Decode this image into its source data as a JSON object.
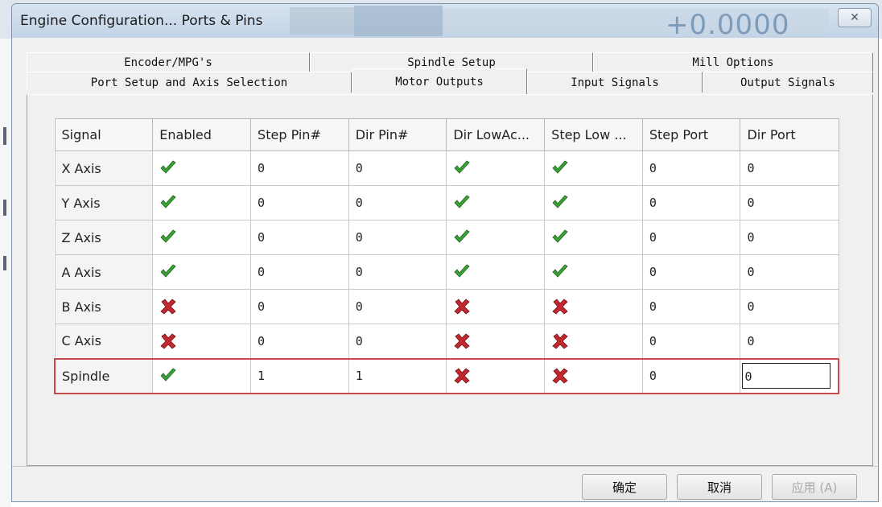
{
  "window": {
    "title": "Engine Configuration... Ports & Pins",
    "background_dro": "+0.0000",
    "close_label": "✕"
  },
  "tabs": {
    "row1": [
      "Encoder/MPG's",
      "Spindle Setup",
      "Mill Options"
    ],
    "row2": [
      "Port Setup and Axis Selection",
      "Motor Outputs",
      "Input Signals",
      "Output Signals"
    ],
    "active": "Motor Outputs"
  },
  "grid": {
    "columns": [
      "Signal",
      "Enabled",
      "Step Pin#",
      "Dir Pin#",
      "Dir LowAc...",
      "Step Low ...",
      "Step Port",
      "Dir Port"
    ],
    "rows": [
      {
        "signal": "X Axis",
        "enabled": true,
        "step_pin": "0",
        "dir_pin": "0",
        "dir_low": true,
        "step_low": true,
        "step_port": "0",
        "dir_port": "0"
      },
      {
        "signal": "Y Axis",
        "enabled": true,
        "step_pin": "0",
        "dir_pin": "0",
        "dir_low": true,
        "step_low": true,
        "step_port": "0",
        "dir_port": "0"
      },
      {
        "signal": "Z Axis",
        "enabled": true,
        "step_pin": "0",
        "dir_pin": "0",
        "dir_low": true,
        "step_low": true,
        "step_port": "0",
        "dir_port": "0"
      },
      {
        "signal": "A Axis",
        "enabled": true,
        "step_pin": "0",
        "dir_pin": "0",
        "dir_low": true,
        "step_low": true,
        "step_port": "0",
        "dir_port": "0"
      },
      {
        "signal": "B Axis",
        "enabled": false,
        "step_pin": "0",
        "dir_pin": "0",
        "dir_low": false,
        "step_low": false,
        "step_port": "0",
        "dir_port": "0"
      },
      {
        "signal": "C Axis",
        "enabled": false,
        "step_pin": "0",
        "dir_pin": "0",
        "dir_low": false,
        "step_low": false,
        "step_port": "0",
        "dir_port": "0"
      },
      {
        "signal": "Spindle",
        "enabled": true,
        "step_pin": "1",
        "dir_pin": "1",
        "dir_low": false,
        "step_low": false,
        "step_port": "0",
        "dir_port": "0"
      }
    ],
    "highlighted_row": "Spindle",
    "highlight_color": "#c94a4a"
  },
  "icons": {
    "true": "green-check-icon",
    "false": "red-x-icon",
    "check_color": "#3aa335",
    "x_color": "#c4272d"
  },
  "buttons": {
    "ok": "确定",
    "cancel": "取消",
    "apply": "应用 (A)"
  }
}
